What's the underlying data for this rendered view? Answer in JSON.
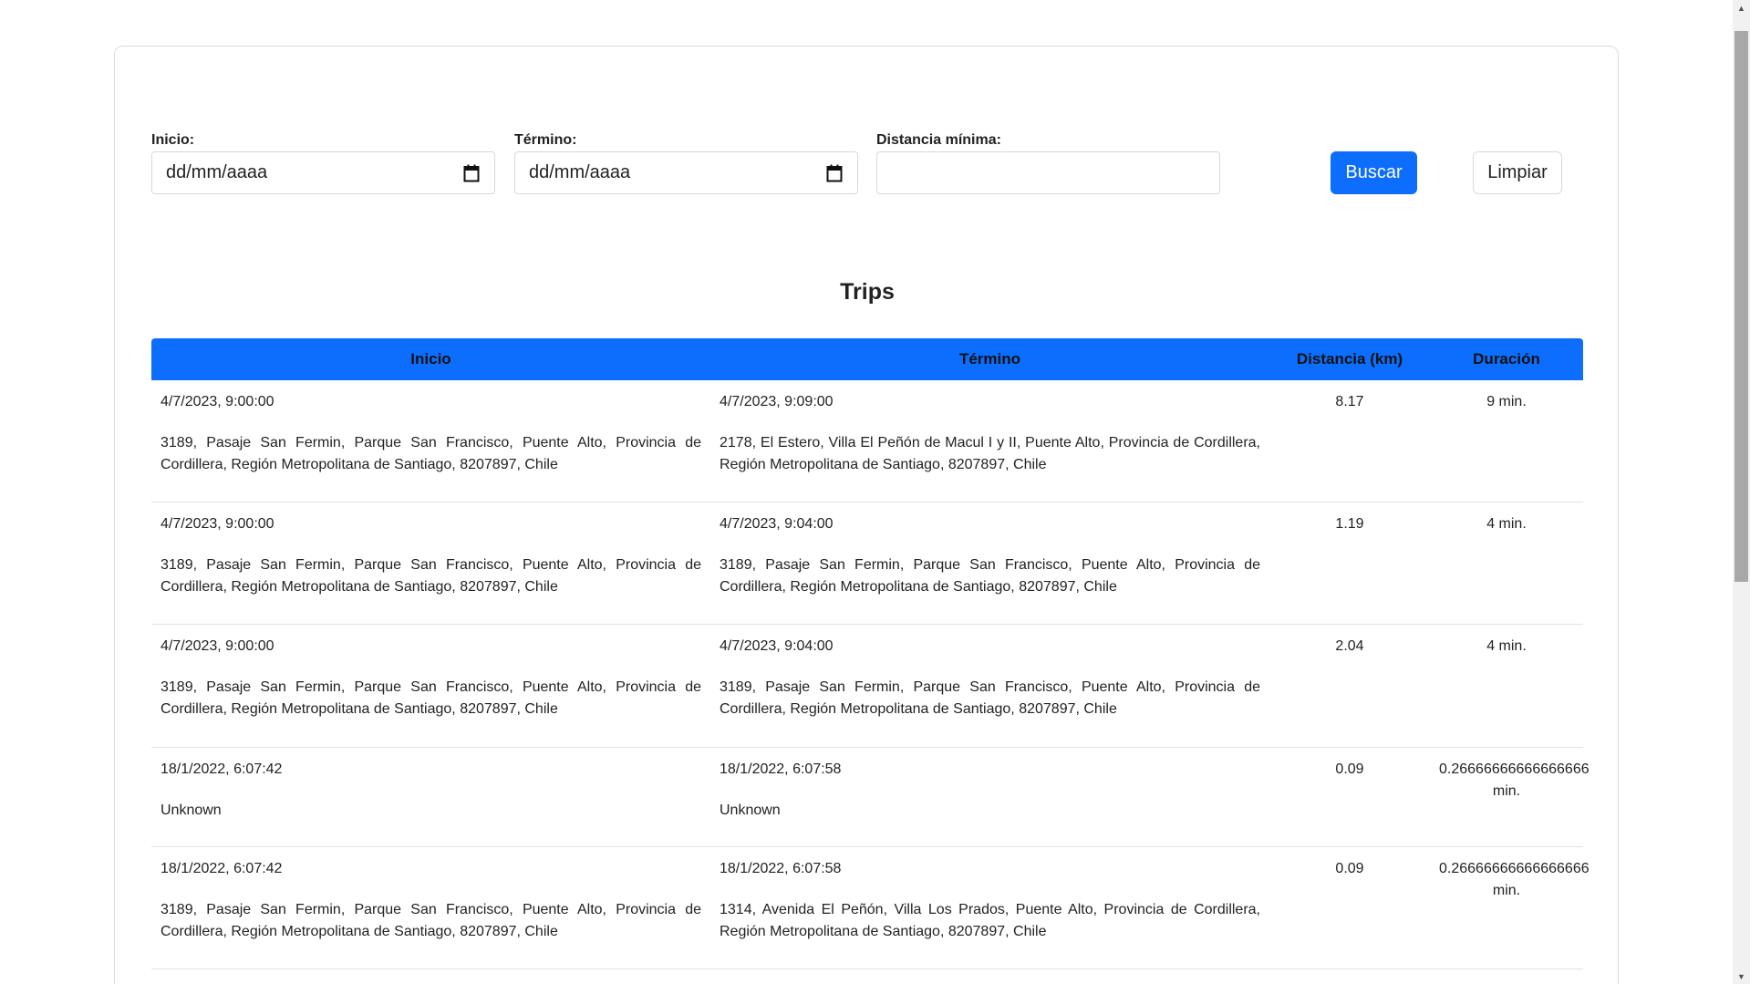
{
  "filters": {
    "inicio_label": "Inicio:",
    "inicio_value": "dd/mm/aaaa",
    "termino_label": "Término:",
    "termino_value": "dd/mm/aaaa",
    "distancia_label": "Distancia mínima:",
    "distancia_value": "",
    "buscar_label": "Buscar",
    "limpiar_label": "Limpiar"
  },
  "title": "Trips",
  "table": {
    "headers": [
      "Inicio",
      "Término",
      "Distancia (km)",
      "Duración"
    ],
    "rows": [
      {
        "start_time": "4/7/2023, 9:00:00",
        "start_addr": "3189, Pasaje San Fermin, Parque San Francisco, Puente Alto, Provincia de Cordillera, Región Metropolitana de Santiago, 8207897, Chile",
        "end_time": "4/7/2023, 9:09:00",
        "end_addr": "2178, El Estero, Villa El Peñón de Macul I y II, Puente Alto, Provincia de Cordillera, Región Metropolitana de Santiago, 8207897, Chile",
        "distance": "8.17",
        "duration": "9 min."
      },
      {
        "start_time": "4/7/2023, 9:00:00",
        "start_addr": "3189, Pasaje San Fermin, Parque San Francisco, Puente Alto, Provincia de Cordillera, Región Metropolitana de Santiago, 8207897, Chile",
        "end_time": "4/7/2023, 9:04:00",
        "end_addr": "3189, Pasaje San Fermin, Parque San Francisco, Puente Alto, Provincia de Cordillera, Región Metropolitana de Santiago, 8207897, Chile",
        "distance": "1.19",
        "duration": "4 min."
      },
      {
        "start_time": "4/7/2023, 9:00:00",
        "start_addr": "3189, Pasaje San Fermin, Parque San Francisco, Puente Alto, Provincia de Cordillera, Región Metropolitana de Santiago, 8207897, Chile",
        "end_time": "4/7/2023, 9:04:00",
        "end_addr": "3189, Pasaje San Fermin, Parque San Francisco, Puente Alto, Provincia de Cordillera, Región Metropolitana de Santiago, 8207897, Chile",
        "distance": "2.04",
        "duration": "4 min."
      },
      {
        "start_time": "18/1/2022, 6:07:42",
        "start_addr": "Unknown",
        "end_time": "18/1/2022, 6:07:58",
        "end_addr": "Unknown",
        "distance": "0.09",
        "duration": "0.26666666666666666 min."
      },
      {
        "start_time": "18/1/2022, 6:07:42",
        "start_addr": "3189, Pasaje San Fermin, Parque San Francisco, Puente Alto, Provincia de Cordillera, Región Metropolitana de Santiago, 8207897, Chile",
        "end_time": "18/1/2022, 6:07:58",
        "end_addr": "1314, Avenida El Peñón, Villa Los Prados, Puente Alto, Provincia de Cordillera, Región Metropolitana de Santiago, 8207897, Chile",
        "distance": "0.09",
        "duration": "0.26666666666666666 min."
      }
    ]
  },
  "colors": {
    "accent": "#0d6efd",
    "border": "#dcdcdc"
  },
  "icons": {
    "calendar": "calendar-icon"
  }
}
